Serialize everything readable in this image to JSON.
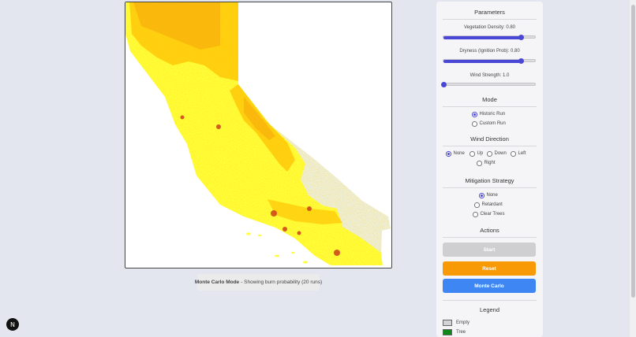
{
  "status": {
    "mode_label": "Monte Carlo Mode",
    "description": "- Showing burn probability (20 runs)"
  },
  "parameters": {
    "title": "Parameters",
    "vegetation": {
      "label": "Vegetation Density: 0.80",
      "value": 0.8
    },
    "dryness": {
      "label": "Dryness (Ignition Prob): 0.80",
      "value": 0.8
    },
    "wind_strength": {
      "label": "Wind Strength: 1.0",
      "value": 0.0
    }
  },
  "mode": {
    "title": "Mode",
    "options": [
      "Historic Run",
      "Custom Run"
    ],
    "selected": "Historic Run"
  },
  "wind_direction": {
    "title": "Wind Direction",
    "options": [
      "None",
      "Up",
      "Down",
      "Left",
      "Right"
    ],
    "selected": "None"
  },
  "mitigation": {
    "title": "Mitigation Strategy",
    "options": [
      "None",
      "Retardant",
      "Clear Trees"
    ],
    "selected": "None"
  },
  "actions": {
    "title": "Actions",
    "start_label": "Start",
    "reset_label": "Reset",
    "monte_carlo_label": "Monte Carlo",
    "start_color": "#cfcfd2",
    "reset_color": "#f79a06",
    "monte_carlo_color": "#3f86f5"
  },
  "legend": {
    "title": "Legend",
    "items": [
      {
        "label": "Empty",
        "color": "#d3d3d3"
      },
      {
        "label": "Tree",
        "color": "#0f8a1a"
      }
    ]
  },
  "map": {
    "land_color": "#eef0dc",
    "low_color": "#ffff3a",
    "mid_color": "#ffc90a",
    "high_color": "#f28a0a",
    "hot_color": "#c9331a"
  },
  "badge": {
    "letter": "N"
  }
}
